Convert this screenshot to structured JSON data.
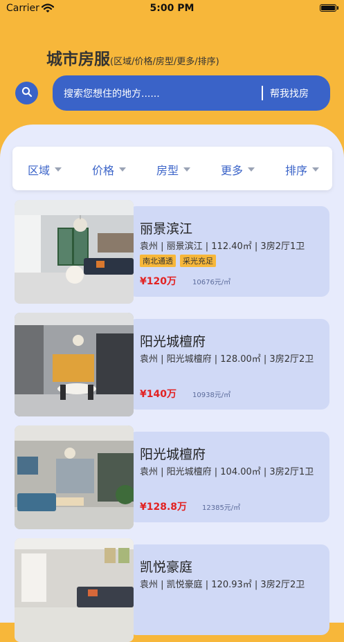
{
  "status_bar": {
    "carrier": "Carrier",
    "time": "5:00 PM"
  },
  "header": {
    "title": "城市房服",
    "subtitle": "(区域/价格/房型/更多/排序)"
  },
  "search": {
    "placeholder": "搜索您想住的地方......",
    "action_label": "帮我找房"
  },
  "filters": [
    {
      "label": "区域"
    },
    {
      "label": "价格"
    },
    {
      "label": "房型"
    },
    {
      "label": "更多"
    },
    {
      "label": "排序"
    }
  ],
  "listings": [
    {
      "title": "丽景滨江",
      "meta": "袁州 | 丽景滨江 | 112.40㎡ | 3房2厅1卫",
      "tags": [
        "南北通透",
        "采光充足"
      ],
      "price": "¥120万",
      "unit_price": "10676元/㎡"
    },
    {
      "title": "阳光城檀府",
      "meta": "袁州 | 阳光城檀府 | 128.00㎡ | 3房2厅2卫",
      "tags": [],
      "price": "¥140万",
      "unit_price": "10938元/㎡"
    },
    {
      "title": "阳光城檀府",
      "meta": "袁州 | 阳光城檀府 | 104.00㎡ | 3房2厅1卫",
      "tags": [],
      "price": "¥128.8万",
      "unit_price": "12385元/㎡"
    },
    {
      "title": "凯悦豪庭",
      "meta": "袁州 | 凯悦豪庭 | 120.93㎡ | 3房2厅2卫",
      "tags": [],
      "price": "",
      "unit_price": ""
    }
  ],
  "colors": {
    "accent": "#f7b73a",
    "primary": "#3a63c8",
    "card_bg": "#d0d9f6",
    "page_bg": "#e7ebfc",
    "price": "#e22222"
  }
}
